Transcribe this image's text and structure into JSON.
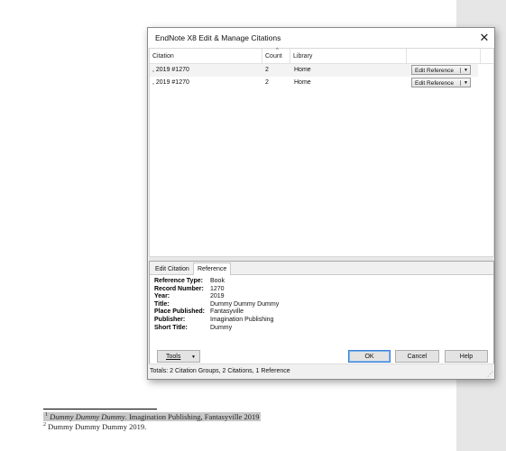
{
  "dialog": {
    "title": "EndNote X8 Edit & Manage Citations",
    "close_label": "✕"
  },
  "grid": {
    "columns": [
      "Citation",
      "Count",
      "Library",
      ""
    ],
    "rows": [
      {
        "citation": ", 2019 #1270",
        "count": "2",
        "library": "Home",
        "action": "Edit Reference"
      },
      {
        "citation": ", 2019 #1270",
        "count": "2",
        "library": "Home",
        "action": "Edit Reference"
      }
    ]
  },
  "tabs": [
    {
      "label": "Edit Citation"
    },
    {
      "label": "Reference",
      "active": true
    }
  ],
  "reference": [
    {
      "label": "Reference Type:",
      "value": "Book"
    },
    {
      "label": "Record Number:",
      "value": "1270"
    },
    {
      "label": "Year:",
      "value": "2019"
    },
    {
      "label": "Title:",
      "value": "Dummy Dummy Dummy"
    },
    {
      "label": "Place Published:",
      "value": "Fantasyville"
    },
    {
      "label": "Publisher:",
      "value": "Imagination Publishing"
    },
    {
      "label": "Short Title:",
      "value": "Dummy"
    }
  ],
  "buttons": {
    "tools": "Tools",
    "ok": "OK",
    "cancel": "Cancel",
    "help": "Help"
  },
  "status": "Totals: 2 Citation Groups, 2 Citations, 1 Reference",
  "document": {
    "footnote1_num": "1",
    "footnote1_italic": "Dummy Dummy Dummy",
    "footnote1_rest": ". Imagination Publishing, Fantasyville 2019",
    "footnote2_num": "2",
    "footnote2_text": " Dummy Dummy Dummy 2019."
  },
  "colors": {
    "ok_border": "#3c7fd6",
    "selection": "#c8c8c8"
  }
}
